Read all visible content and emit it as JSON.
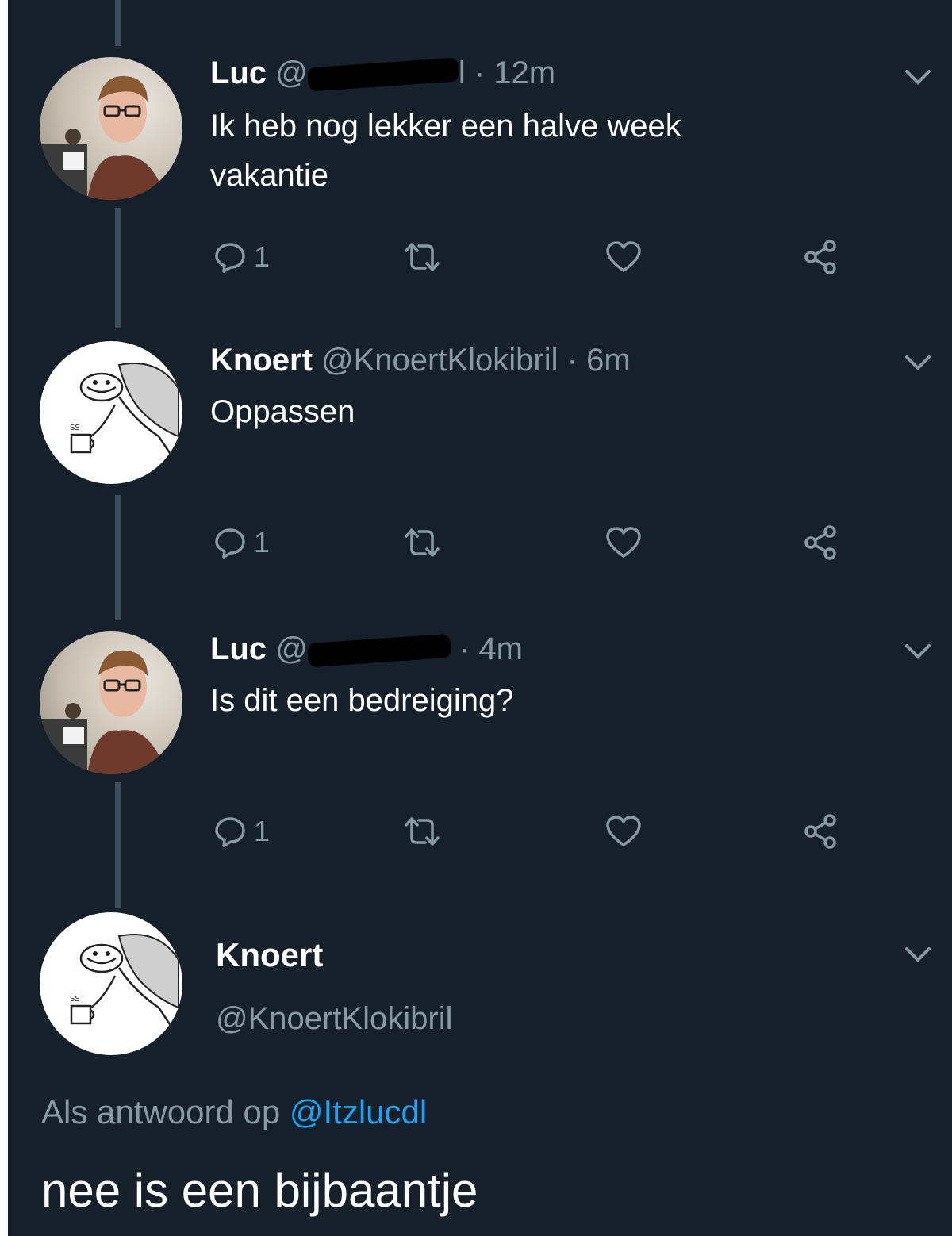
{
  "tweets": [
    {
      "name": "Luc",
      "handle_prefix": "@",
      "handle_tail": "l",
      "time": "· 12m",
      "text_lines": [
        "Ik heb nog lekker een halve week",
        "vakantie"
      ],
      "reply_count": "1"
    },
    {
      "name": "Knoert",
      "handle": "@KnoertKlokibril",
      "time": "· 6m",
      "text_lines": [
        "Oppassen"
      ],
      "reply_count": "1"
    },
    {
      "name": "Luc",
      "handle_prefix": "@",
      "handle_tail": "",
      "time": "· 4m",
      "text_lines": [
        "Is dit een bedreiging?"
      ],
      "reply_count": "1"
    }
  ],
  "focused": {
    "name": "Knoert",
    "handle": "@KnoertKlokibril",
    "reply_to_prefix": "Als antwoord op",
    "reply_to_mention": "@Itzlucdl",
    "text": "nee is een bijbaantje"
  },
  "icons": {
    "reply": "reply-icon",
    "retweet": "retweet-icon",
    "like": "heart-icon",
    "share": "share-icon",
    "more": "chevron-down-icon"
  },
  "colors": {
    "background": "#15202b",
    "thread_line": "#3d4c5b",
    "secondary_text": "#8899a6",
    "mention": "#1da1f2"
  }
}
